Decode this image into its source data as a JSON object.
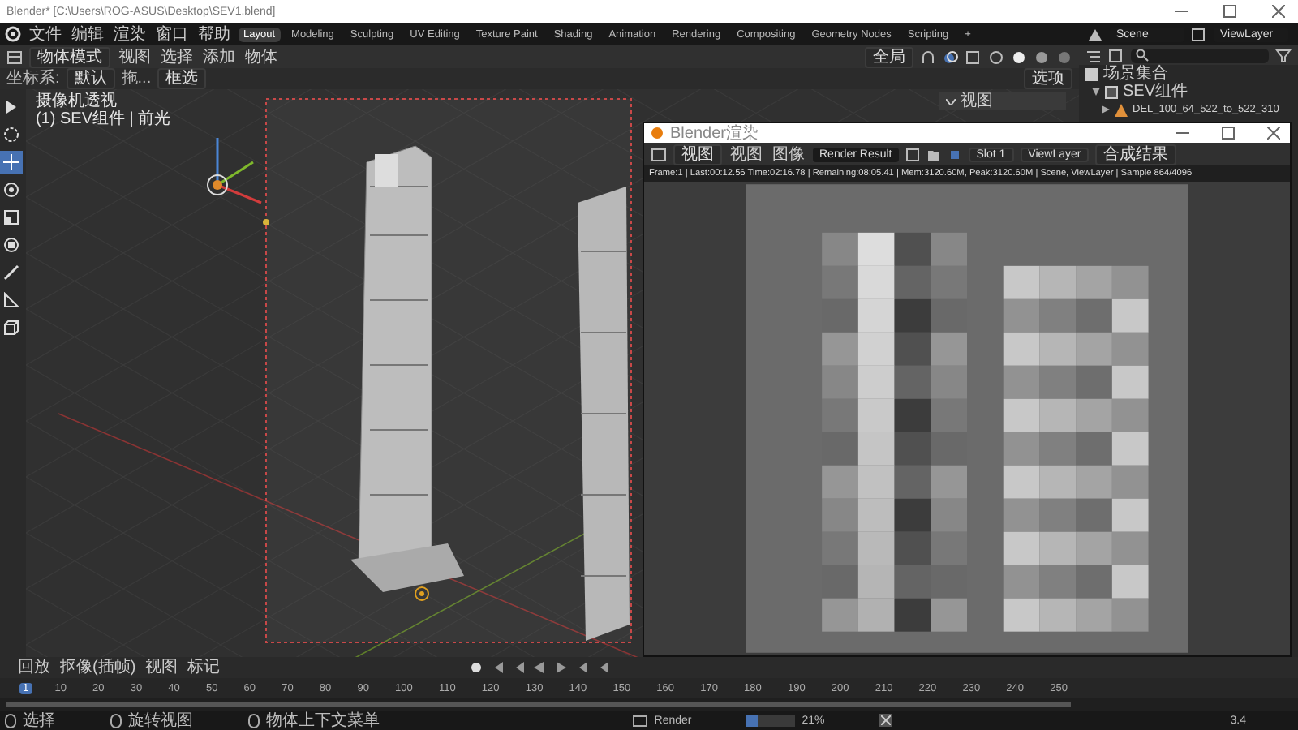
{
  "title_bar": {
    "title": "Blender* [C:\\Users\\ROG-ASUS\\Desktop\\SEV1.blend]"
  },
  "menu": [
    "文件",
    "编辑",
    "渲染",
    "窗口",
    "帮助"
  ],
  "workspaces": [
    {
      "label": "Layout",
      "selected": true
    },
    {
      "label": "Modeling",
      "selected": false
    },
    {
      "label": "Sculpting",
      "selected": false
    },
    {
      "label": "UV Editing",
      "selected": false
    },
    {
      "label": "Texture Paint",
      "selected": false
    },
    {
      "label": "Shading",
      "selected": false
    },
    {
      "label": "Animation",
      "selected": false
    },
    {
      "label": "Rendering",
      "selected": false
    },
    {
      "label": "Compositing",
      "selected": false
    },
    {
      "label": "Geometry Nodes",
      "selected": false
    },
    {
      "label": "Scripting",
      "selected": false
    }
  ],
  "add_workspace": "+",
  "scene": "Scene",
  "view_layer": "ViewLayer",
  "viewport_header": {
    "mode": "物体模式",
    "menus": [
      "视图",
      "选择",
      "添加",
      "物体"
    ],
    "orientation": "全局"
  },
  "tool_settings": {
    "coord_label": "坐标系:",
    "coord_value": "默认",
    "drag_label": "拖...",
    "drag_value": "框选",
    "options": "选项"
  },
  "toolbar": [
    {
      "kind": "select",
      "selected": false
    },
    {
      "kind": "cursor",
      "selected": false
    },
    {
      "kind": "move",
      "selected": true
    },
    {
      "kind": "rotate",
      "selected": false
    },
    {
      "kind": "scale",
      "selected": false
    },
    {
      "kind": "transform",
      "selected": false
    },
    {
      "kind": "annotate",
      "selected": false
    },
    {
      "kind": "measure",
      "selected": false
    },
    {
      "kind": "add-cube",
      "selected": false
    }
  ],
  "viewport": {
    "view_name": "摄像机透视",
    "collection": "(1) SEV组件 | 前光",
    "sidebar_tab": "视图"
  },
  "outliner": [
    {
      "label": "场景集合",
      "kind": "scene",
      "children": [
        {
          "label": "SEV组件",
          "kind": "collection",
          "expanded": true,
          "children": [
            {
              "label": "DEL_100_64_522_to_522_310",
              "kind": "mesh",
              "expanded": false
            }
          ]
        }
      ]
    }
  ],
  "render_window": {
    "title": "Blender渲染",
    "view_menu": "视图",
    "menus": [
      "视图",
      "图像"
    ],
    "image_name": "Render Result",
    "slot": "Slot 1",
    "layer": "ViewLayer",
    "pass": "合成结果",
    "info": "Frame:1 | Last:00:12.56 Time:02:16.78 | Remaining:08:05.41 | Mem:3120.60M, Peak:3120.60M | Scene, ViewLayer | Sample 864/4096"
  },
  "timeline": {
    "menus": [
      "回放",
      "抠像(插帧)",
      "视图",
      "标记"
    ],
    "frames": [
      {
        "label": "1",
        "selected": true
      },
      {
        "label": "10",
        "selected": false
      },
      {
        "label": "20",
        "selected": false
      },
      {
        "label": "30",
        "selected": false
      },
      {
        "label": "40",
        "selected": false
      },
      {
        "label": "50",
        "selected": false
      },
      {
        "label": "60",
        "selected": false
      },
      {
        "label": "70",
        "selected": false
      },
      {
        "label": "80",
        "selected": false
      },
      {
        "label": "90",
        "selected": false
      },
      {
        "label": "100",
        "selected": false
      },
      {
        "label": "110",
        "selected": false
      },
      {
        "label": "120",
        "selected": false
      },
      {
        "label": "130",
        "selected": false
      },
      {
        "label": "140",
        "selected": false
      },
      {
        "label": "150",
        "selected": false
      },
      {
        "label": "160",
        "selected": false
      },
      {
        "label": "170",
        "selected": false
      },
      {
        "label": "180",
        "selected": false
      },
      {
        "label": "190",
        "selected": false
      },
      {
        "label": "200",
        "selected": false
      },
      {
        "label": "210",
        "selected": false
      },
      {
        "label": "220",
        "selected": false
      },
      {
        "label": "230",
        "selected": false
      },
      {
        "label": "240",
        "selected": false
      },
      {
        "label": "250",
        "selected": false
      }
    ]
  },
  "status_bar": {
    "hints": [
      "选择",
      "旋转视图",
      "物体上下文菜单"
    ],
    "job": "Render",
    "progress": {
      "level": 0.21
    },
    "percent": "21%",
    "version": "3.4"
  }
}
